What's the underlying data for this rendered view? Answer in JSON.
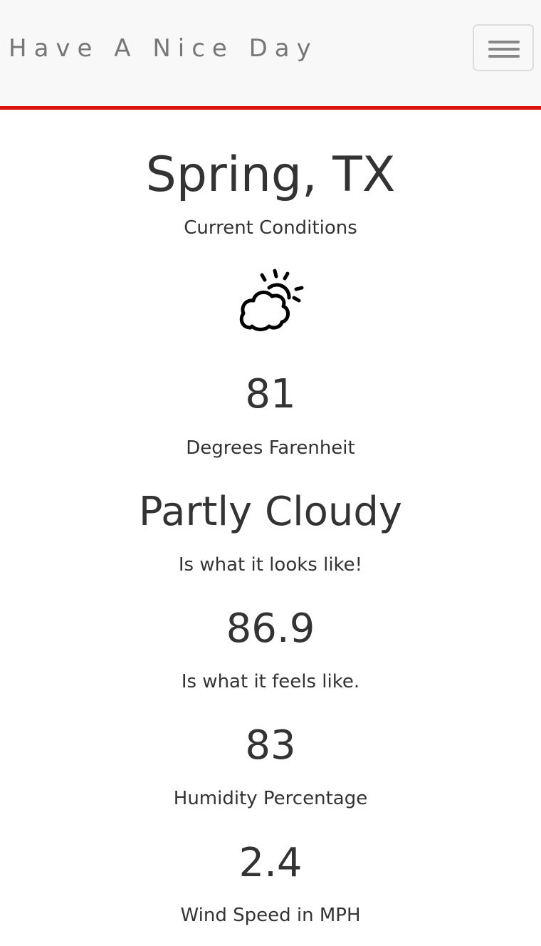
{
  "navbar": {
    "brand": "Have A Nice Day",
    "accent_color": "#d9120d",
    "menu_icon": "hamburger-menu-icon"
  },
  "weather": {
    "location": "Spring, TX",
    "subtitle": "Current Conditions",
    "icon": "partly-cloudy-icon",
    "temperature": "81",
    "temperature_label": "Degrees Farenheit",
    "condition": "Partly Cloudy",
    "condition_label": "Is what it looks like!",
    "feels_like": "86.9",
    "feels_like_label": "Is what it feels like.",
    "humidity": "83",
    "humidity_label": "Humidity Percentage",
    "wind_speed": "2.4",
    "wind_speed_label": "Wind Speed in MPH"
  }
}
